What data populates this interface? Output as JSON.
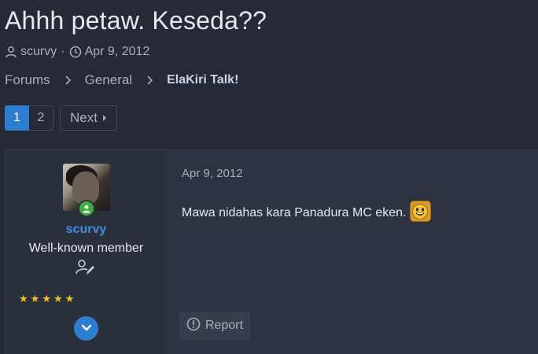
{
  "thread": {
    "title": "Ahhh petaw. Keseda??",
    "author": "scurvy",
    "separator": "·",
    "date": "Apr 9, 2012"
  },
  "breadcrumb": {
    "items": [
      "Forums",
      "General",
      "ElaKiri Talk!"
    ]
  },
  "pagination": {
    "pages": [
      "1",
      "2"
    ],
    "current": "1",
    "next_label": "Next"
  },
  "post": {
    "username": "scurvy",
    "user_title": "Well-known member",
    "stars": [
      "★",
      "★",
      "★",
      "★",
      "★"
    ],
    "date": "Apr 9, 2012",
    "message": "Mawa nidahas kara Panadura MC eken.",
    "report_label": "Report"
  },
  "colors": {
    "accent": "#2f7dcf",
    "username": "#3d8fe0",
    "online": "#3fae3f",
    "star": "#f2c318",
    "background": "#252a36"
  },
  "icons": {
    "author": "user-icon",
    "date": "clock-icon",
    "breadcrumb_separator": "chevron-right-icon",
    "next": "caret-right-icon",
    "online": "online-status-icon",
    "user_edit": "user-edit-icon",
    "expand": "chevron-down-icon",
    "report": "alert-circle-icon",
    "smiley": "smiley-icon"
  }
}
